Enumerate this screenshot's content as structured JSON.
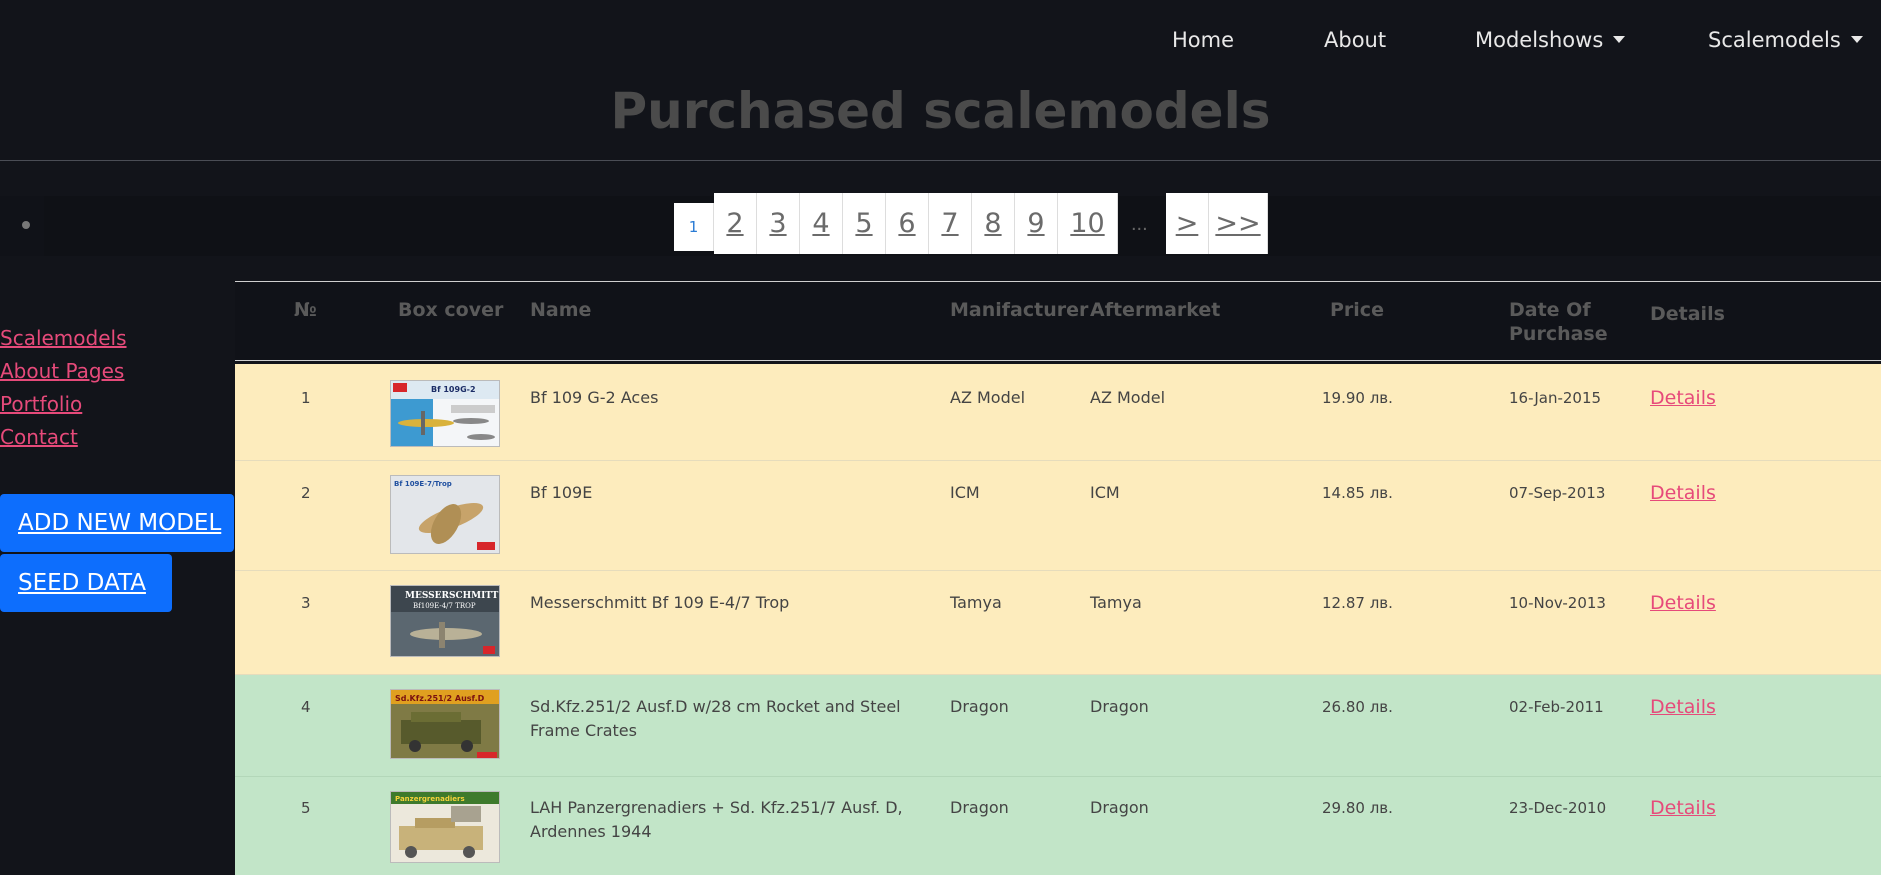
{
  "nav": {
    "home": "Home",
    "about": "About",
    "modelshows": "Modelshows",
    "scalemodels": "Scalemodels"
  },
  "page_title": "Purchased scalemodels",
  "pagination": {
    "active": "1",
    "pages": [
      "2",
      "3",
      "4",
      "5",
      "6",
      "7",
      "8",
      "9",
      "10"
    ],
    "ellipsis": "...",
    "next": ">",
    "last": ">>"
  },
  "sidebar": {
    "links": [
      "Scalemodels",
      "About",
      "Pages",
      "Portfolio",
      "Contact"
    ],
    "add_button": "ADD NEW MODEL",
    "seed_button": "SEED DATA"
  },
  "table": {
    "headers": {
      "num": "№",
      "box_cover": "Box cover",
      "name": "Name",
      "manufacturer": "Manifacturer",
      "aftermarket": "Aftermarket",
      "price": "Price",
      "date_line1": "Date Of",
      "date_line2": "Purchase",
      "details": "Details"
    },
    "rows": [
      {
        "num": "1",
        "name_line1": "Bf 109 G-2 Aces",
        "name_line2": "",
        "manufacturer": "AZ Model",
        "aftermarket": "AZ Model",
        "price": "19.90 лв.",
        "date": "16-Jan-2015",
        "details": "Details",
        "row_color": "#fdecbd"
      },
      {
        "num": "2",
        "name_line1": "Bf 109E",
        "name_line2": "",
        "manufacturer": "ICM",
        "aftermarket": "ICM",
        "price": "14.85 лв.",
        "date": "07-Sep-2013",
        "details": "Details",
        "row_color": "#fdecbd"
      },
      {
        "num": "3",
        "name_line1": "Messerschmitt Bf 109 E-4/7 Trop",
        "name_line2": "",
        "manufacturer": "Tamya",
        "aftermarket": "Tamya",
        "price": "12.87 лв.",
        "date": "10-Nov-2013",
        "details": "Details",
        "row_color": "#fdecbd"
      },
      {
        "num": "4",
        "name_line1": "Sd.Kfz.251/2 Ausf.D w/28 cm Rocket and Steel",
        "name_line2": "Frame Crates",
        "manufacturer": "Dragon",
        "aftermarket": "Dragon",
        "price": "26.80 лв.",
        "date": "02-Feb-2011",
        "details": "Details",
        "row_color": "#c2e5c8"
      },
      {
        "num": "5",
        "name_line1": "LAH Panzergrenadiers + Sd. Kfz.251/7 Ausf. D,",
        "name_line2": "Ardennes 1944",
        "manufacturer": "Dragon",
        "aftermarket": "Dragon",
        "price": "29.80 лв.",
        "date": "23-Dec-2010",
        "details": "Details",
        "row_color": "#c2e5c8"
      }
    ],
    "box_art_text": {
      "row1": "Bf 109G-2",
      "row2": "Bf 109E-7/Trop",
      "row3_line1": "MESSERSCHMITT",
      "row3_line2": "Bf109E-4/7 TROP",
      "row4": "Sd.Kfz.251/2 Ausf.D",
      "row5": "Panzergrenadiers"
    }
  },
  "colors": {
    "background": "#12141a",
    "link_pink": "#e64a7a",
    "button_blue": "#0d6efd",
    "row_yellow": "#fdecbd",
    "row_green": "#c2e5c8"
  }
}
